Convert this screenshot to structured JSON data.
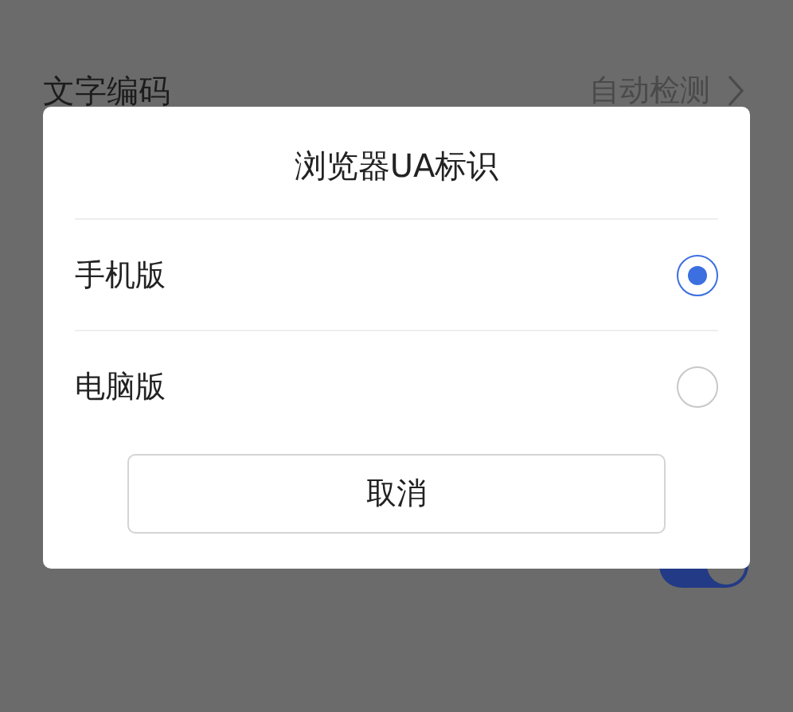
{
  "background_settings": [
    {
      "kind": "link",
      "label": "文字编码",
      "value": "自动检测"
    },
    {
      "kind": "toggle",
      "on": true
    }
  ],
  "dialog": {
    "title": "浏览器UA标识",
    "options": [
      {
        "label": "手机版",
        "selected": true
      },
      {
        "label": "电脑版",
        "selected": false
      }
    ],
    "cancel_button": "取消"
  }
}
